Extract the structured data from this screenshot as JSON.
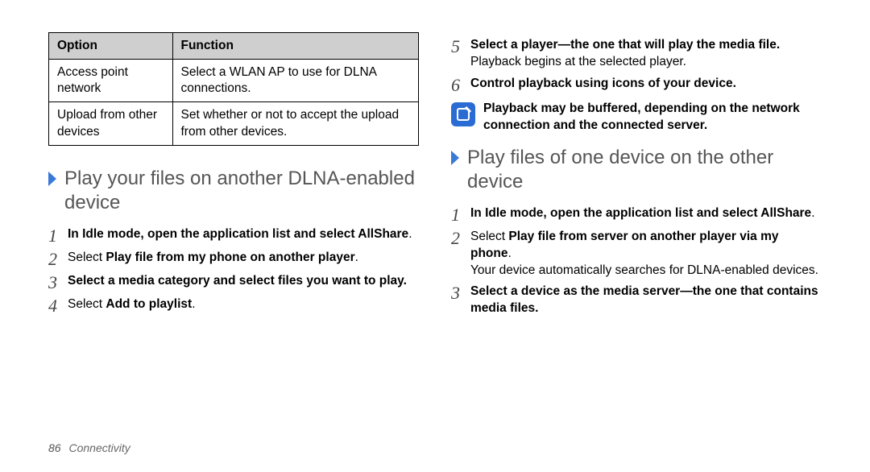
{
  "table": {
    "headers": {
      "option": "Option",
      "function": "Function"
    },
    "rows": [
      {
        "option": "Access point network",
        "function": "Select a WLAN AP to use for DLNA connections."
      },
      {
        "option": "Upload from other devices",
        "function": "Set whether or not to accept the upload from other devices."
      }
    ]
  },
  "left": {
    "heading": "Play your files on another DLNA-enabled device",
    "steps": {
      "s1a": "In Idle mode, open the application list and select ",
      "s1b": "AllShare",
      "s1c": ".",
      "s2a": "Select ",
      "s2b": "Play file from my phone on another player",
      "s2c": ".",
      "s3": "Select a media category and select files you want to play.",
      "s4a": "Select ",
      "s4b": "Add to playlist",
      "s4c": "."
    }
  },
  "right": {
    "steps_top": {
      "s5a": "Select a player—the one that will play the media file. ",
      "s5b": "Playback begins at the selected player.",
      "s6": "Control playback using icons of your device."
    },
    "note": "Playback may be buffered, depending on the network connection and the connected server.",
    "heading": "Play files of one device on the other device",
    "steps": {
      "s1a": "In Idle mode, open the application list and select ",
      "s1b": "AllShare",
      "s1c": ".",
      "s2a": "Select ",
      "s2b": "Play file from server on another player via my phone",
      "s2c": ".",
      "s2d": "Your device automatically searches for DLNA-enabled devices.",
      "s3": "Select a device as the media server—the one that contains media files."
    }
  },
  "nums": {
    "n1": "1",
    "n2": "2",
    "n3": "3",
    "n4": "4",
    "n5": "5",
    "n6": "6"
  },
  "footer": {
    "page": "86",
    "section": "Connectivity"
  }
}
